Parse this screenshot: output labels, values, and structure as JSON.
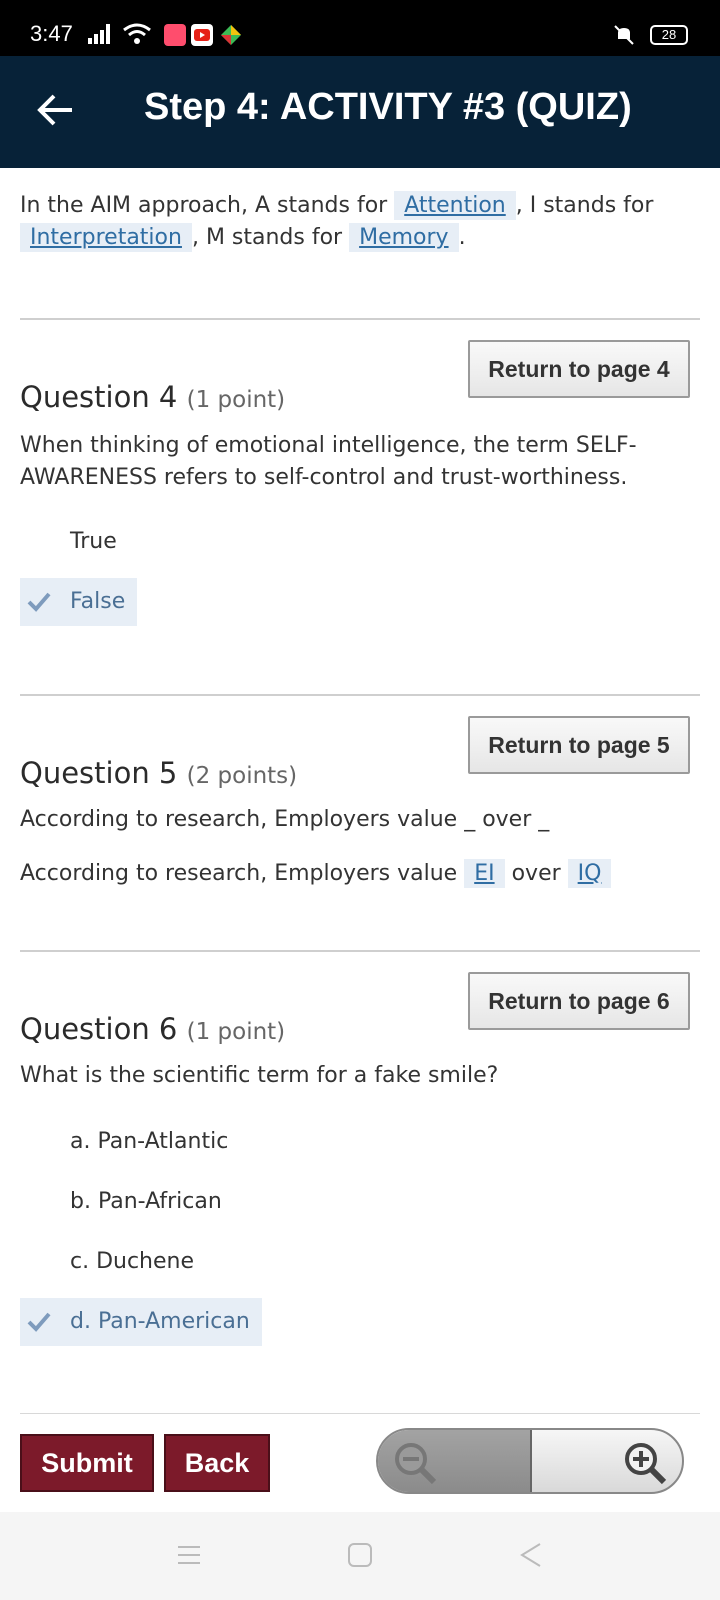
{
  "status_bar": {
    "time": "3:47",
    "battery": "28",
    "icons": [
      "signal-icon",
      "wifi-icon",
      "music-app-icon",
      "youtube-app-icon",
      "games-app-icon",
      "vibrate-mute-icon",
      "battery-icon"
    ]
  },
  "app_bar": {
    "title": "Step 4: ACTIVITY #3  (QUIZ)",
    "back_icon": "back-arrow-icon"
  },
  "intro": {
    "part1": "In the AIM approach, A stands for ",
    "answer1": "Attention",
    "part2": ", I stands for ",
    "answer2": "Interpretation",
    "part3": ", M stands for ",
    "answer3": "Memory",
    "part4": "."
  },
  "questions": [
    {
      "number": "Question 4",
      "points": "(1 point)",
      "return_label": "Return to page 4",
      "text": "When thinking of emotional intelligence, the term SELF-AWARENESS refers to self-control and trust-worthiness.",
      "options": [
        {
          "label": "True",
          "selected": false
        },
        {
          "label": "False",
          "selected": true
        }
      ]
    },
    {
      "number": "Question 5",
      "points": "(2 points)",
      "return_label": "Return to page 5",
      "text": "According to research, Employers value _ over _",
      "answer_line": {
        "part1": "According to research, Employers value ",
        "answer1": "EI",
        "part2": " over ",
        "answer2": "IQ"
      }
    },
    {
      "number": "Question 6",
      "points": "(1 point)",
      "return_label": "Return to page 6",
      "text": "What is the scientific term for a fake smile?",
      "options": [
        {
          "label": "a. Pan-Atlantic",
          "selected": false
        },
        {
          "label": "b. Pan-African",
          "selected": false
        },
        {
          "label": "c. Duchene",
          "selected": false
        },
        {
          "label": "d. Pan-American",
          "selected": true
        }
      ]
    }
  ],
  "footer": {
    "submit_label": "Submit",
    "back_label": "Back",
    "zoom_out_icon": "zoom-out-icon",
    "zoom_in_icon": "zoom-in-icon"
  },
  "nav_bar": {
    "icons": [
      "menu-icon",
      "home-icon",
      "back-triangle-icon"
    ]
  },
  "colors": {
    "app_bar": "#072238",
    "answer_bg": "#e7eef6",
    "answer_text": "#2f6da3",
    "primary_button": "#7c1a2a"
  }
}
